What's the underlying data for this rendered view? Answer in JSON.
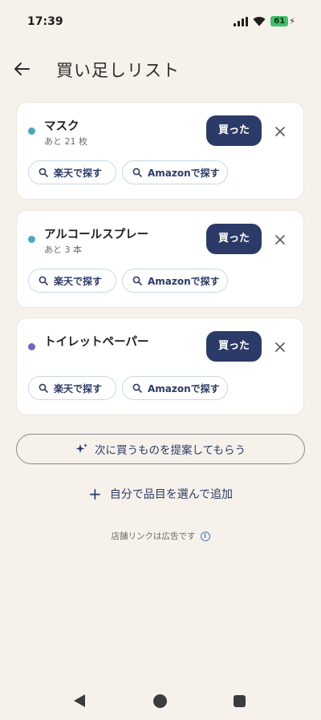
{
  "status_bar": {
    "time": "17:39",
    "battery_level": "61"
  },
  "header": {
    "title": "買い足しリスト",
    "back_icon": "arrow-left-icon"
  },
  "items": [
    {
      "name": "マスク",
      "remaining": "あと 21 枚",
      "dot_color": "#4aa8c0",
      "bought_label": "買った",
      "rakuten_label": "楽天で探す",
      "amazon_label": "Amazonで探す"
    },
    {
      "name": "アルコールスプレー",
      "remaining": "あと 3 本",
      "dot_color": "#4aa8c0",
      "bought_label": "買った",
      "rakuten_label": "楽天で探す",
      "amazon_label": "Amazonで探す"
    },
    {
      "name": "トイレットペーパー",
      "remaining": "",
      "dot_color": "#7a62c4",
      "bought_label": "買った",
      "rakuten_label": "楽天で探す",
      "amazon_label": "Amazonで探す"
    }
  ],
  "actions": {
    "suggest_label": "次に買うものを提案してもらう",
    "suggest_icon": "sparkle-icon",
    "add_label": "自分で品目を選んで追加"
  },
  "footer_note": "店舗リンクは広告です",
  "colors": {
    "primary": "#2b3a67",
    "background": "#f6f1ea",
    "card": "#ffffff",
    "chip_border": "#c5d9e6"
  }
}
